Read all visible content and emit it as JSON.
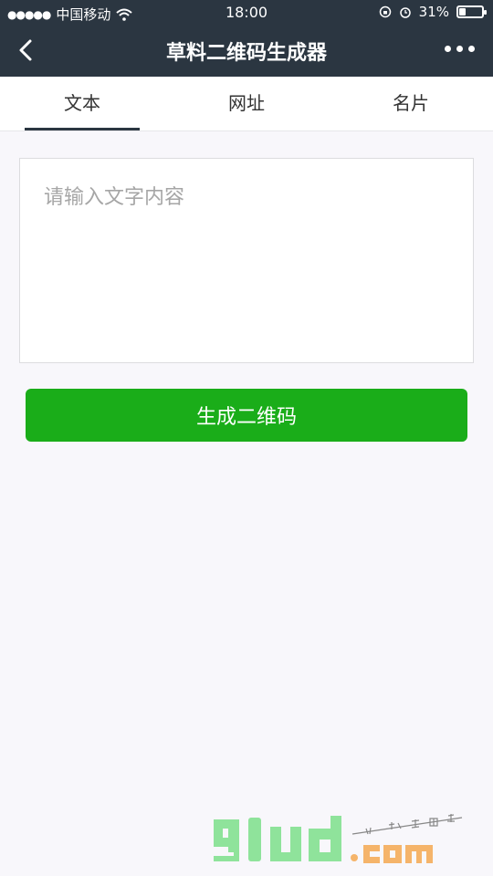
{
  "status_bar": {
    "signal_dots": "●●●●●",
    "carrier": "中国移动",
    "wifi_icon": "wifi-icon",
    "time": "18:00",
    "battery_percent": "31%",
    "battery_level": 0.31
  },
  "nav": {
    "title": "草料二维码生成器",
    "back_icon": "chevron-left-icon",
    "more_icon": "more-dots-icon"
  },
  "tabs": [
    {
      "label": "文本",
      "active": true
    },
    {
      "label": "网址",
      "active": false
    },
    {
      "label": "名片",
      "active": false
    }
  ],
  "text_input": {
    "value": "",
    "placeholder": "请输入文字内容"
  },
  "generate_button": {
    "label": "生成二维码"
  },
  "watermark": {
    "logo_text": "91ud",
    "domain": ".com",
    "tagline": "小程序商店"
  },
  "colors": {
    "nav_bg": "#2b3641",
    "primary_green": "#1aad19",
    "page_bg": "#f8f7fb",
    "watermark_green": "#8fe39b",
    "watermark_orange": "#f5b46a"
  }
}
